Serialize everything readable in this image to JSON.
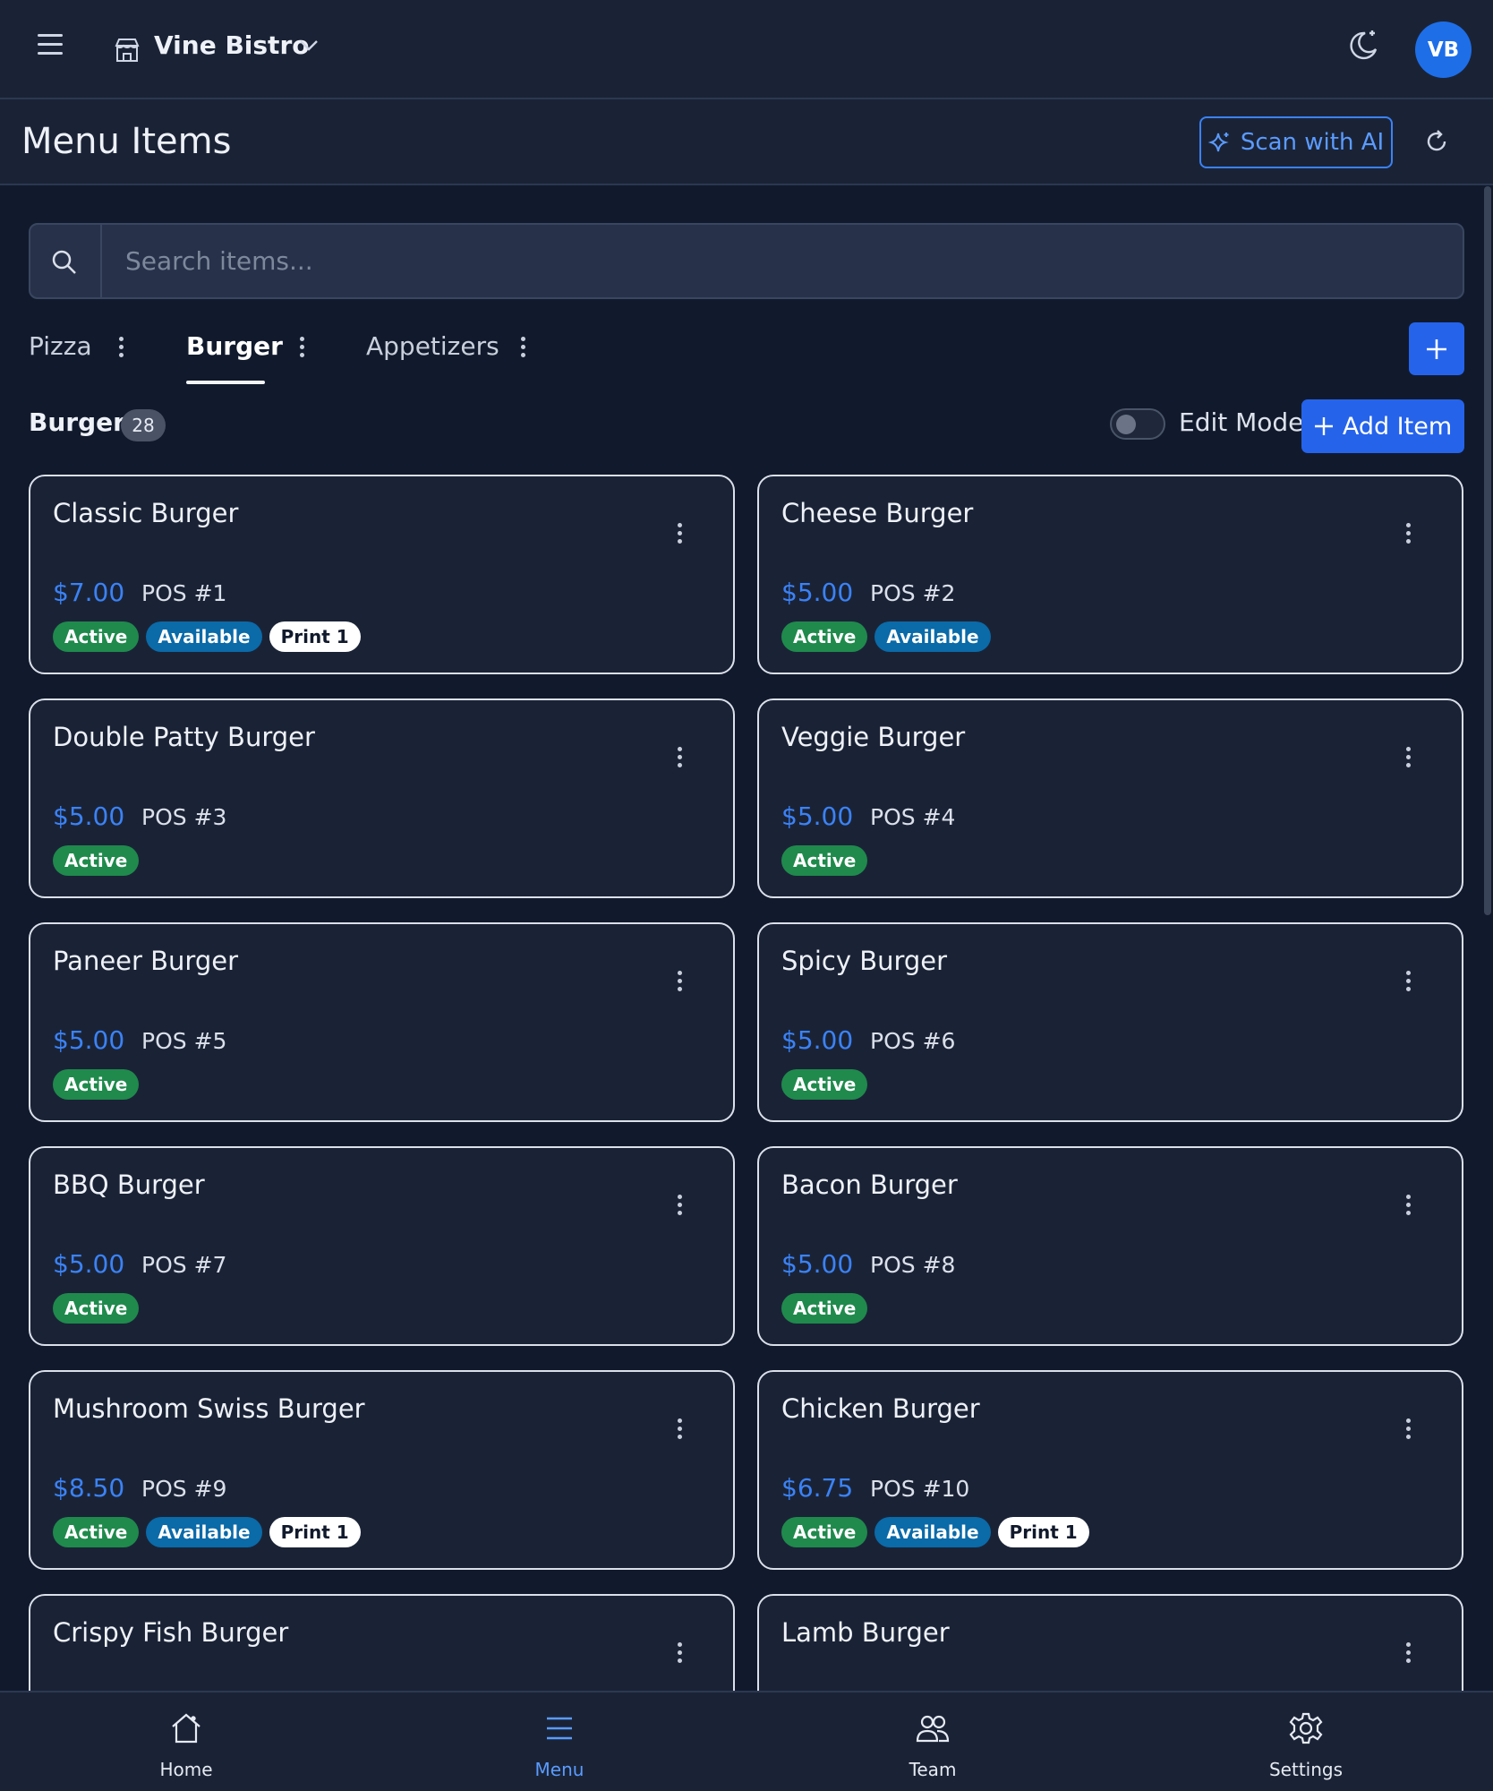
{
  "topbar": {
    "store_name": "Vine Bistro",
    "avatar_initials": "VB"
  },
  "page": {
    "title": "Menu Items",
    "scan_button_label": "Scan with AI"
  },
  "search": {
    "placeholder": "Search items...",
    "value": ""
  },
  "tabs": [
    {
      "label": "Pizza",
      "active": false
    },
    {
      "label": "Burger",
      "active": true
    },
    {
      "label": "Appetizers",
      "active": false
    }
  ],
  "section": {
    "title": "Burger",
    "count": "28",
    "edit_mode_label": "Edit Mode",
    "edit_mode_on": false,
    "add_item_label": "Add Item"
  },
  "items": [
    {
      "name": "Classic Burger",
      "price": "$7.00",
      "pos": "POS #1",
      "badges": [
        "Active",
        "Available",
        "Print 1"
      ]
    },
    {
      "name": "Cheese Burger",
      "price": "$5.00",
      "pos": "POS #2",
      "badges": [
        "Active",
        "Available"
      ]
    },
    {
      "name": "Double Patty Burger",
      "price": "$5.00",
      "pos": "POS #3",
      "badges": [
        "Active"
      ]
    },
    {
      "name": "Veggie Burger",
      "price": "$5.00",
      "pos": "POS #4",
      "badges": [
        "Active"
      ]
    },
    {
      "name": "Paneer Burger",
      "price": "$5.00",
      "pos": "POS #5",
      "badges": [
        "Active"
      ]
    },
    {
      "name": "Spicy Burger",
      "price": "$5.00",
      "pos": "POS #6",
      "badges": [
        "Active"
      ]
    },
    {
      "name": "BBQ Burger",
      "price": "$5.00",
      "pos": "POS #7",
      "badges": [
        "Active"
      ]
    },
    {
      "name": "Bacon Burger",
      "price": "$5.00",
      "pos": "POS #8",
      "badges": [
        "Active"
      ]
    },
    {
      "name": "Mushroom Swiss Burger",
      "price": "$8.50",
      "pos": "POS #9",
      "badges": [
        "Active",
        "Available",
        "Print 1"
      ]
    },
    {
      "name": "Chicken Burger",
      "price": "$6.75",
      "pos": "POS #10",
      "badges": [
        "Active",
        "Available",
        "Print 1"
      ]
    },
    {
      "name": "Crispy Fish Burger",
      "price": "",
      "pos": "",
      "badges": []
    },
    {
      "name": "Lamb Burger",
      "price": "",
      "pos": "",
      "badges": []
    }
  ],
  "bottom_nav": [
    {
      "label": "Home",
      "icon": "home-icon",
      "active": false
    },
    {
      "label": "Menu",
      "icon": "menu-icon",
      "active": true
    },
    {
      "label": "Team",
      "icon": "team-icon",
      "active": false
    },
    {
      "label": "Settings",
      "icon": "settings-icon",
      "active": false
    }
  ],
  "colors": {
    "background": "#111a2c",
    "surface": "#1a2336",
    "accent": "#2563eb",
    "price": "#3b82f6",
    "active_badge": "#1f8a4c",
    "available_badge": "#0b6aa8"
  }
}
